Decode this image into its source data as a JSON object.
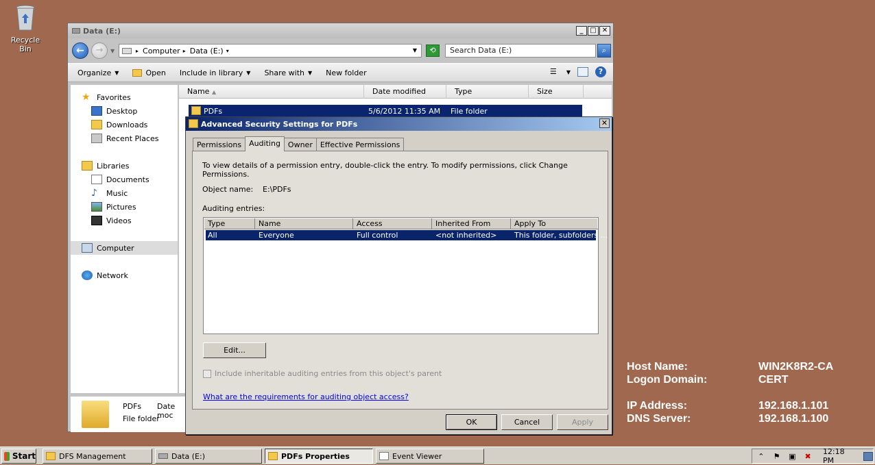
{
  "desktop": {
    "recycle_bin_label": "Recycle Bin",
    "sysinfo": [
      {
        "key": "Host Name:",
        "value": "WIN2K8R2-CA"
      },
      {
        "key": "Logon Domain:",
        "value": "CERT"
      },
      {
        "key": "IP Address:",
        "value": "192.168.1.101"
      },
      {
        "key": "DNS Server:",
        "value": "192.168.1.100"
      }
    ]
  },
  "explorer": {
    "title": "Data (E:)",
    "breadcrumb": [
      "Computer",
      "Data (E:)"
    ],
    "search_placeholder": "Search Data (E:)",
    "toolbar": {
      "organize": "Organize",
      "open": "Open",
      "include": "Include in library",
      "share": "Share with",
      "new_folder": "New folder"
    },
    "nav": {
      "favorites": "Favorites",
      "desktop": "Desktop",
      "downloads": "Downloads",
      "recent": "Recent Places",
      "libraries": "Libraries",
      "documents": "Documents",
      "music": "Music",
      "pictures": "Pictures",
      "videos": "Videos",
      "computer": "Computer",
      "network": "Network"
    },
    "columns": {
      "name": "Name",
      "date": "Date modified",
      "type": "Type",
      "size": "Size"
    },
    "file": {
      "name": "PDFs",
      "date": "5/6/2012 11:35 AM",
      "type": "File folder"
    },
    "details": {
      "name": "PDFs",
      "type": "File folder",
      "date_label": "Date moc"
    }
  },
  "dialog": {
    "title": "Advanced Security Settings for PDFs",
    "tabs": [
      "Permissions",
      "Auditing",
      "Owner",
      "Effective Permissions"
    ],
    "active_tab": "Auditing",
    "instructions": "To view details of a permission entry, double-click the entry. To modify permissions, click Change Permissions.",
    "object_name_label": "Object name:",
    "object_name": "E:\\PDFs",
    "entries_label": "Auditing entries:",
    "columns": [
      "Type",
      "Name",
      "Access",
      "Inherited From",
      "Apply To"
    ],
    "rows": [
      {
        "type": "All",
        "name": "Everyone",
        "access": "Full control",
        "inherited": "<not inherited>",
        "apply": "This folder, subfolders ..."
      }
    ],
    "edit_button": "Edit...",
    "inherit_checkbox": "Include inheritable auditing entries from this object's parent",
    "help_link": "What are the requirements for auditing object access?",
    "ok": "OK",
    "cancel": "Cancel",
    "apply": "Apply"
  },
  "taskbar": {
    "start": "Start",
    "tasks": [
      "DFS Management",
      "Data (E:)",
      "PDFs Properties",
      "Event Viewer"
    ],
    "active_task": "PDFs Properties",
    "clock": "12:18 PM"
  }
}
